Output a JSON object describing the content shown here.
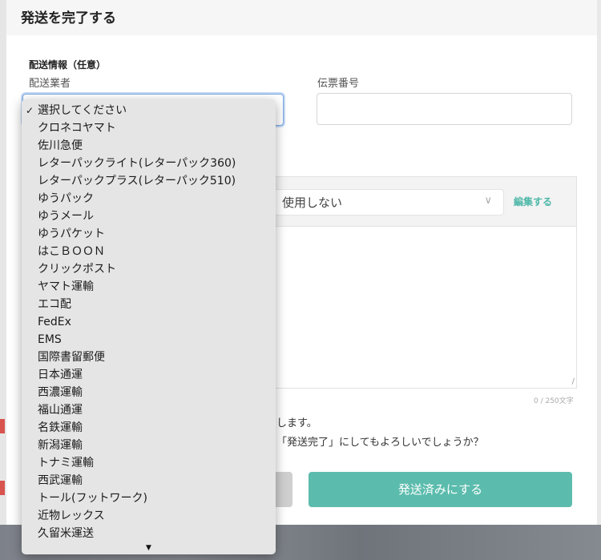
{
  "modal": {
    "title": "発送を完了する",
    "section_label": "配送情報（任意）",
    "carrier_label": "配送業者",
    "tracking_label": "伝票番号"
  },
  "message": {
    "template_value": "使用しない",
    "edit_label": "編集する",
    "char_count": "0 / 250文字"
  },
  "notice": {
    "line1": "します。",
    "line2": "「発送完了」にしてもよろしいでしょうか？"
  },
  "buttons": {
    "submit_label": "発送済みにする"
  },
  "carrier_dropdown": {
    "selected_index": 0,
    "options": [
      "選択してください",
      "クロネコヤマト",
      "佐川急便",
      "レターパックライト(レターパック360)",
      "レターパックプラス(レターパック510)",
      "ゆうパック",
      "ゆうメール",
      "ゆうパケット",
      "はこＢＯＯＮ",
      "クリックポスト",
      "ヤマト運輸",
      "エコ配",
      "FedEx",
      "EMS",
      "国際書留郵便",
      "日本通運",
      "西濃運輸",
      "福山通運",
      "名鉄運輸",
      "新潟運輸",
      "トナミ運輸",
      "西武運輸",
      "トール(フットワーク)",
      "近物レックス",
      "久留米運送"
    ]
  },
  "colors": {
    "accent": "#5bbcad",
    "focus": "#7aa7e0"
  }
}
